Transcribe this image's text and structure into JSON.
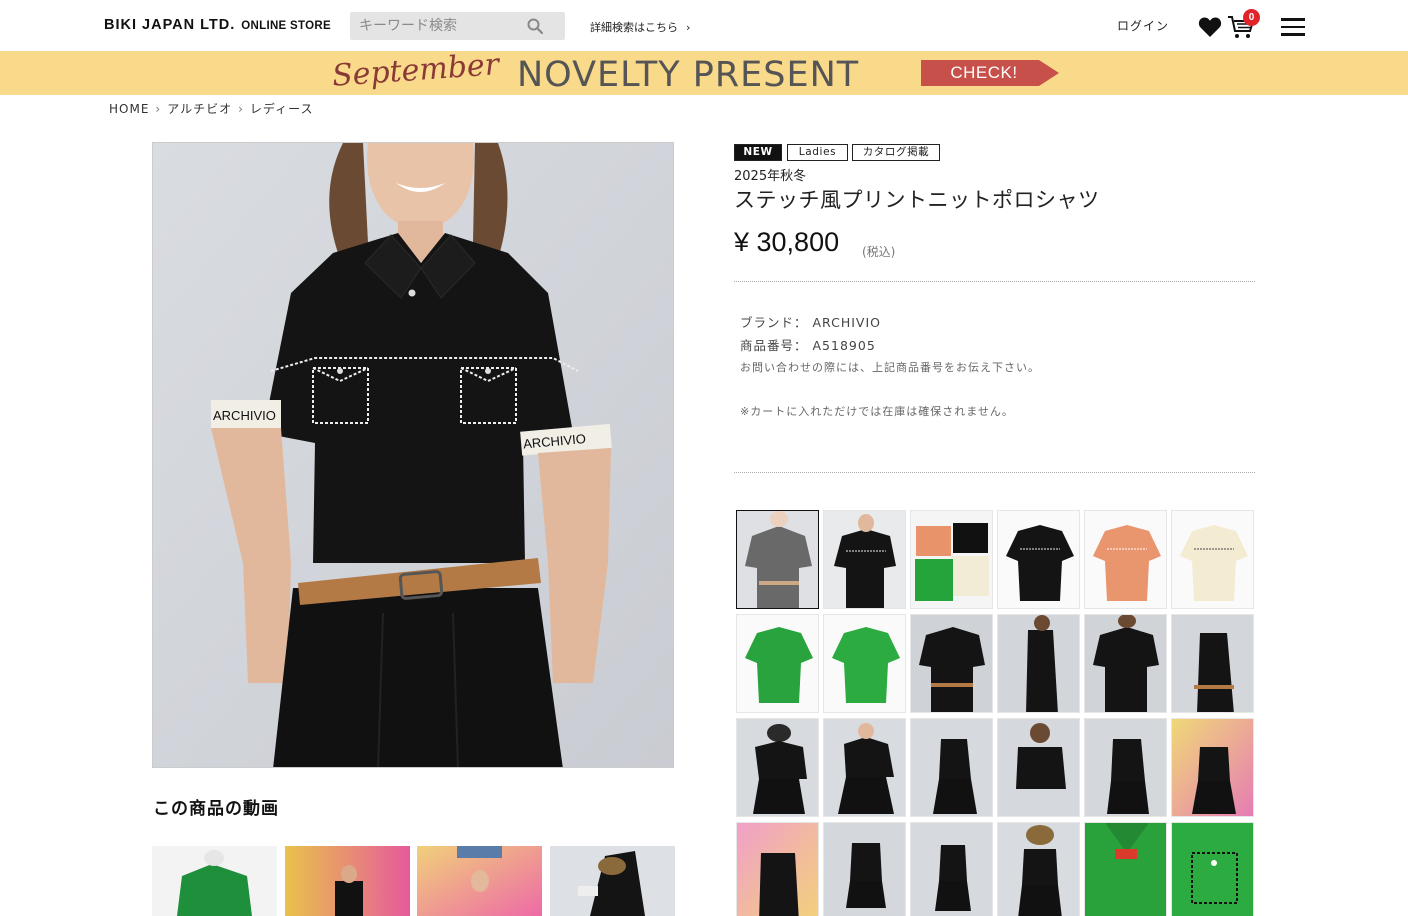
{
  "header": {
    "logo_main": "BIKI JAPAN LTD.",
    "logo_sub": "ONLINE STORE",
    "search_placeholder": "キーワード検索",
    "advanced_search": "詳細検索はこちら",
    "login": "ログイン",
    "cart_count": "0"
  },
  "banner": {
    "script_text": "September",
    "title": "NOVELTY PRESENT",
    "cta": "CHECK!"
  },
  "breadcrumb": [
    "HOME",
    "アルチビオ",
    "レディース"
  ],
  "product": {
    "tags": [
      "NEW",
      "Ladies",
      "カタログ掲載"
    ],
    "season": "2025年秋冬",
    "name": "ステッチ風プリントニットポロシャツ",
    "price": "¥ 30,800",
    "tax": "(税込)",
    "brand_label": "ブランド：",
    "brand_value": "ARCHIVIO",
    "code_label": "商品番号：",
    "code_value": "A518905",
    "note_inquiry": "お問い合わせの際には、上記商品番号をお伝え下さい。",
    "note_stock": "※カートに入れただけでは在庫は確保されません。"
  },
  "sleeve_print": "ARCHIVIO",
  "video_section_title": "この商品の動画",
  "colors": {
    "accent_red": "#e0242a",
    "banner_bg": "#f9d98a",
    "cta_red": "#c8504a"
  }
}
